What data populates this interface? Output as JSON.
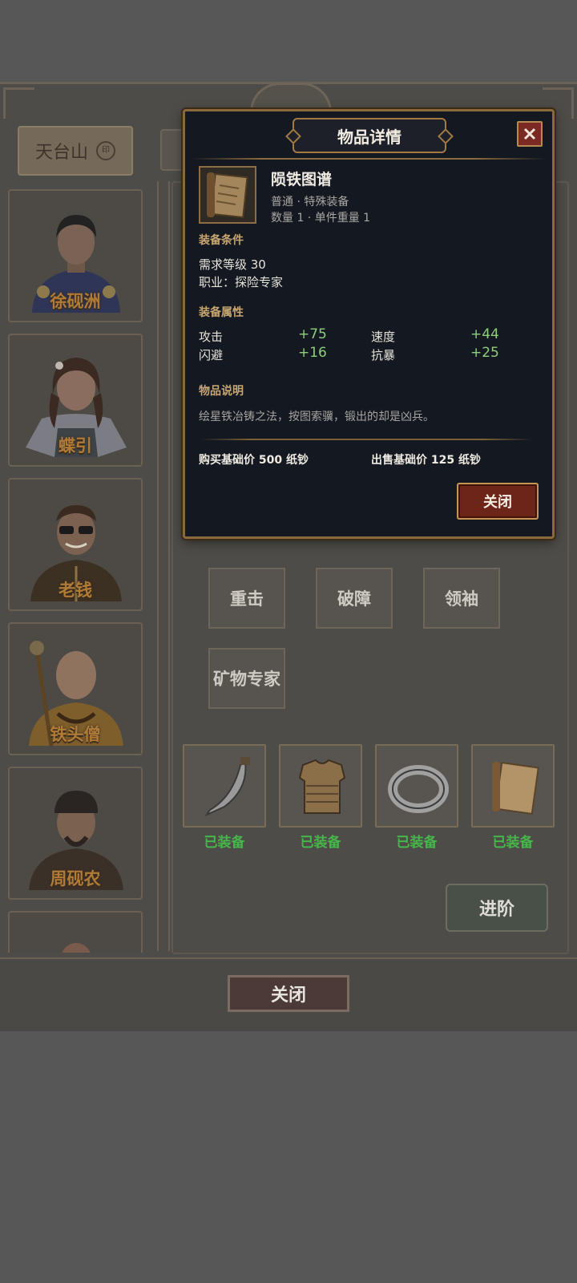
{
  "location": {
    "name": "天台山",
    "seal": "印"
  },
  "characters": [
    {
      "name": "徐砚洲",
      "portrait_icon": "scholar-portrait-icon"
    },
    {
      "name": "蝶引",
      "portrait_icon": "girl-portrait-icon"
    },
    {
      "name": "老钱",
      "portrait_icon": "merchant-portrait-icon"
    },
    {
      "name": "铁头僧",
      "portrait_icon": "monk-portrait-icon"
    },
    {
      "name": "周砚农",
      "portrait_icon": "bandit-portrait-icon"
    }
  ],
  "skills": [
    "重击",
    "破障",
    "领袖",
    "矿物专家"
  ],
  "equipment": [
    {
      "icon": "sword-icon",
      "status": "已装备"
    },
    {
      "icon": "armor-icon",
      "status": "已装备"
    },
    {
      "icon": "ring-icon",
      "status": "已装备"
    },
    {
      "icon": "scroll-icon",
      "status": "已装备"
    }
  ],
  "advance_label": "进阶",
  "close_label": "关闭",
  "modal": {
    "title": "物品详情",
    "item": {
      "name": "陨铁图谱",
      "rarity_type": "普通 · 特殊装备",
      "quantity_weight": "数量 1 · 单件重量 1"
    },
    "requirements_heading": "装备条件",
    "requirements": [
      "需求等级 30",
      "职业：探险专家"
    ],
    "attributes_heading": "装备属性",
    "attributes": [
      {
        "name": "攻击",
        "value": "+75"
      },
      {
        "name": "速度",
        "value": "+44"
      },
      {
        "name": "闪避",
        "value": "+16"
      },
      {
        "name": "抗暴",
        "value": "+25"
      }
    ],
    "description_heading": "物品说明",
    "description": "绘星铁冶铸之法，按图索骥，锻出的却是凶兵。",
    "buy_price": "购买基础价 500 纸钞",
    "sell_price": "出售基础价 125 纸钞",
    "close_label": "关闭"
  },
  "colors": {
    "modal_bg": "#141921",
    "gold_trim": "#8a6a3c",
    "stat_green": "#8dcf7a",
    "equipped_green": "#46b54a",
    "name_orange": "#b07a37"
  }
}
